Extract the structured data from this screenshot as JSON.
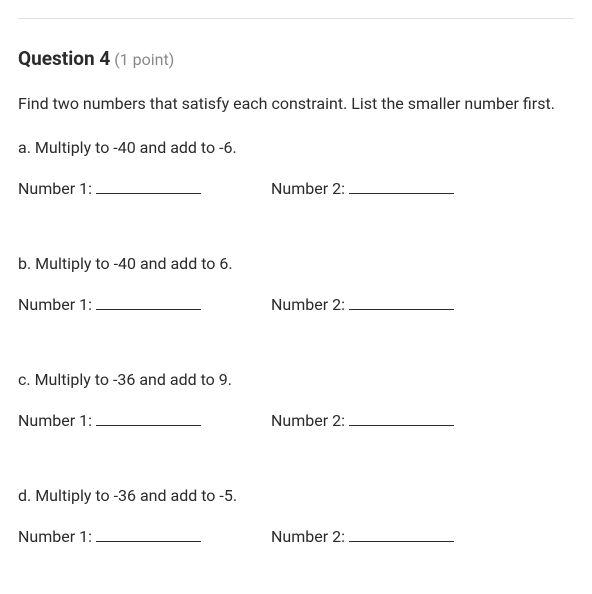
{
  "header": {
    "title": "Question 4",
    "points": " (1 point)"
  },
  "instructions": "Find two numbers that satisfy each constraint.  List the smaller number first.",
  "parts": {
    "a": {
      "constraint": "a.  Multiply to -40 and add to -6.",
      "label1": "Number 1:",
      "label2": "Number 2:"
    },
    "b": {
      "constraint": "b.  Multiply to -40 and add to 6.",
      "label1": "Number 1:",
      "label2": "Number 2:"
    },
    "c": {
      "constraint": "c.  Multiply to -36 and add to 9.",
      "label1": "Number 1:",
      "label2": "Number 2:"
    },
    "d": {
      "constraint": "d.  Multiply to -36 and add to -5.",
      "label1": "Number 1:",
      "label2": "Number 2:"
    }
  }
}
